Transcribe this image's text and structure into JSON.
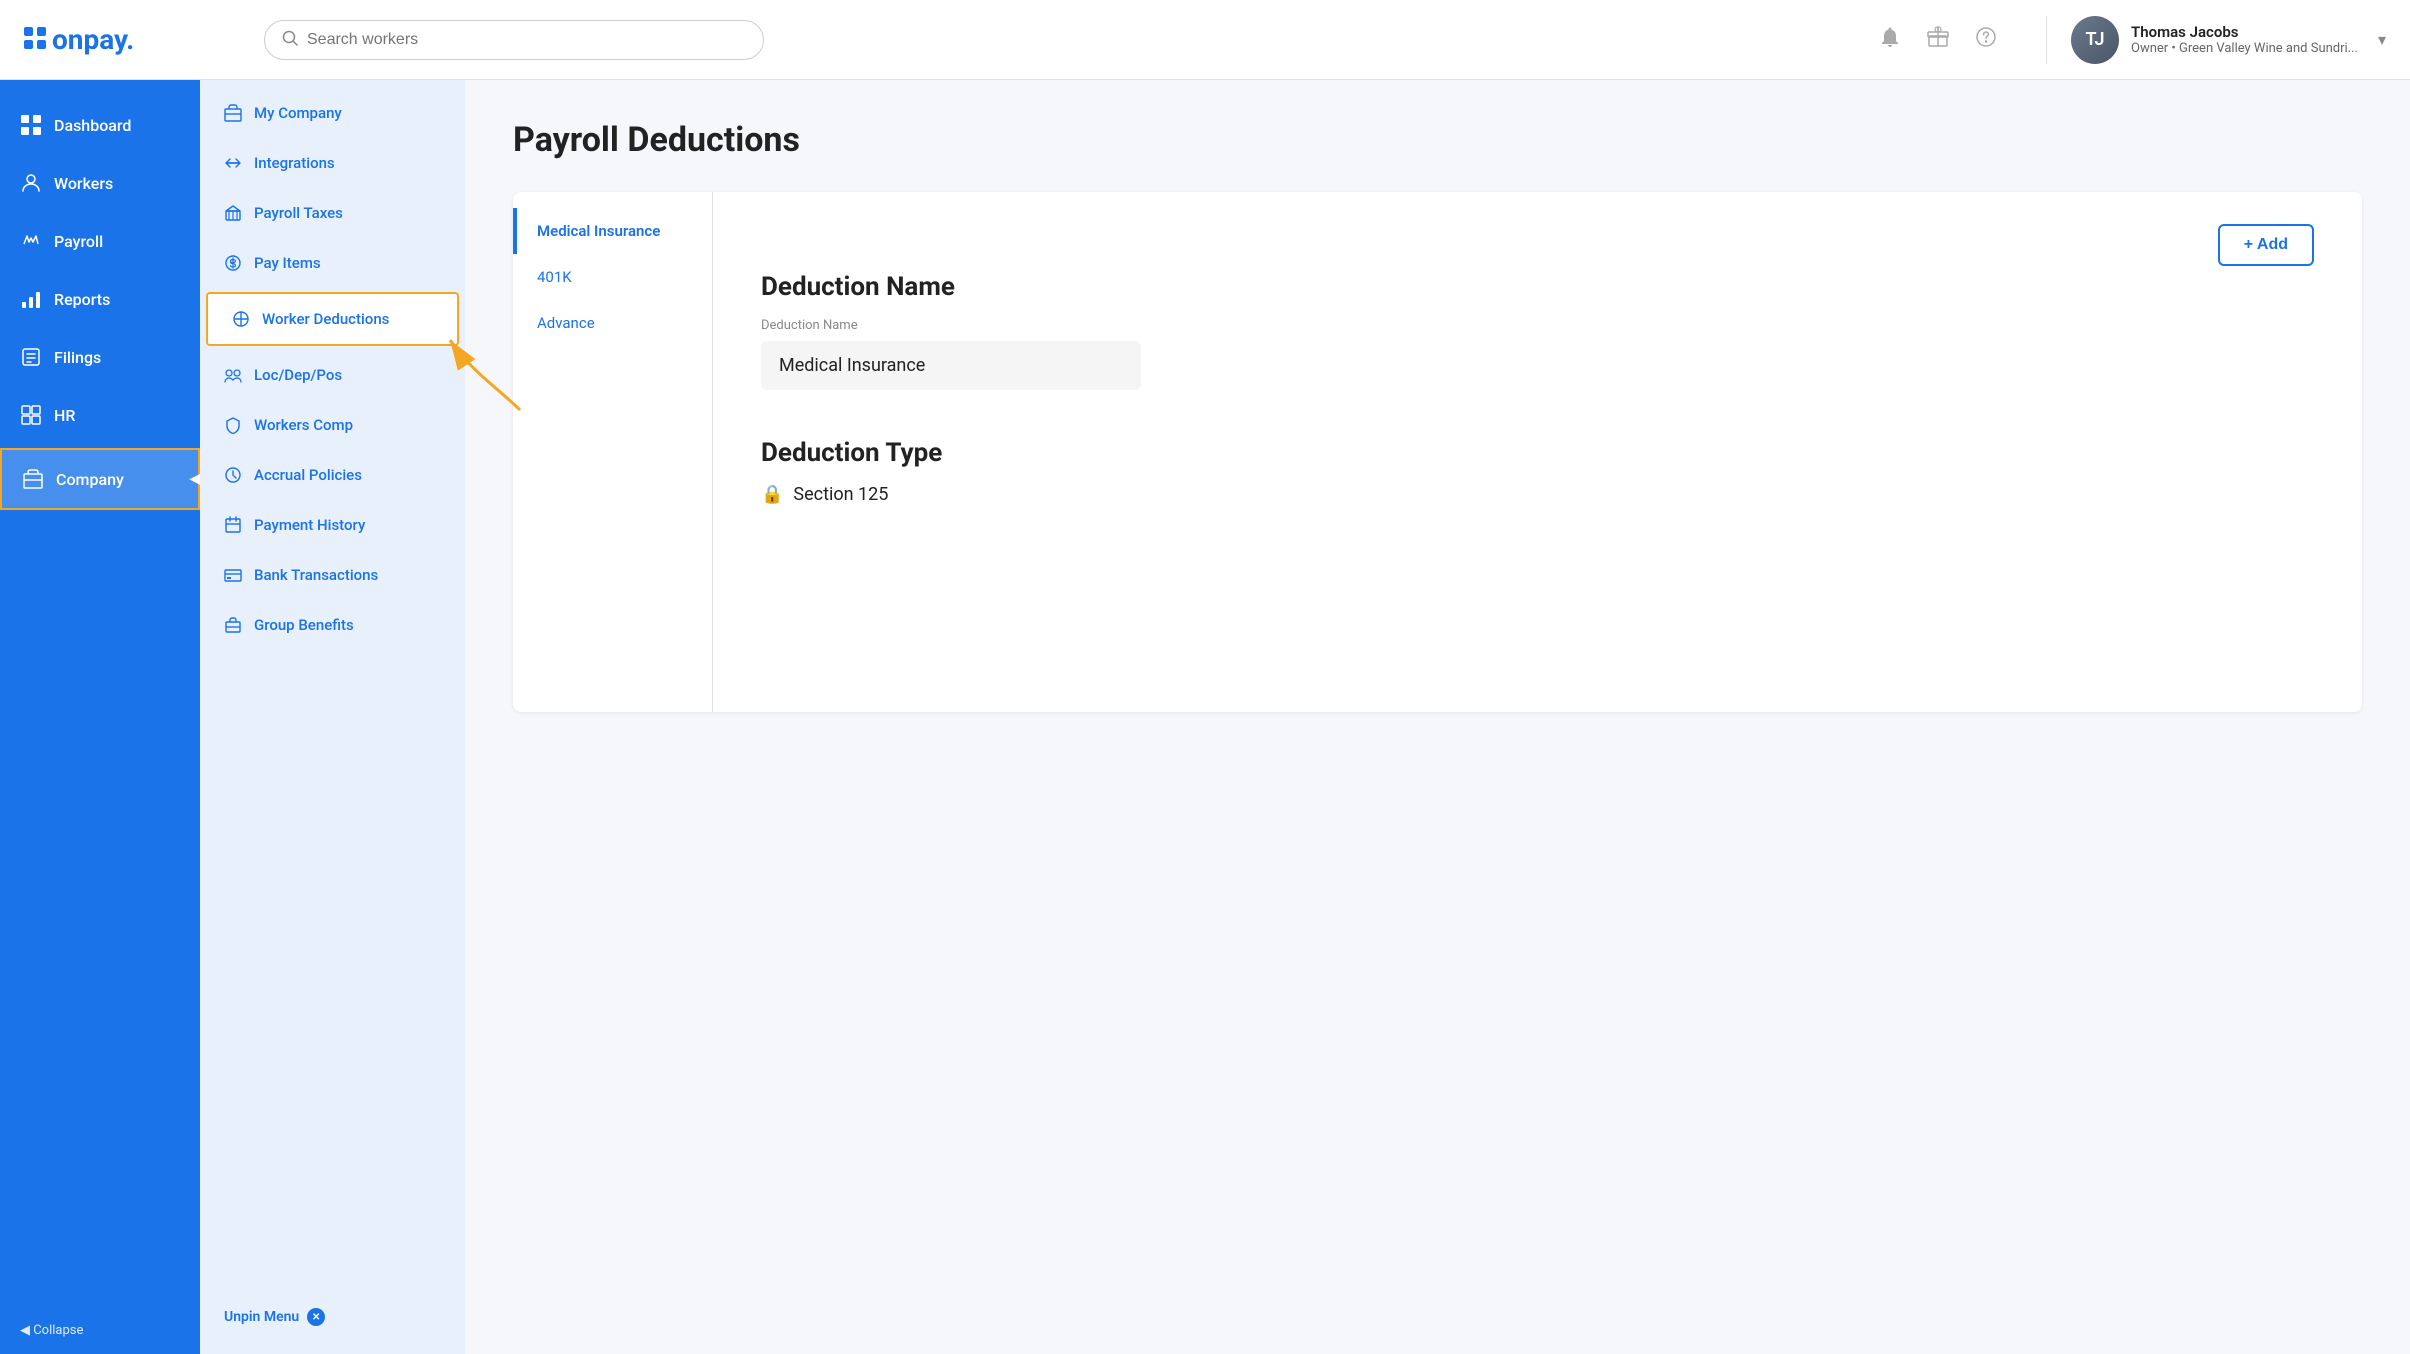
{
  "header": {
    "logo_text": "onpay.",
    "search_placeholder": "Search workers",
    "user_name": "Thomas Jacobs",
    "user_role": "Owner • Green Valley Wine and Sundri...",
    "dropdown_icon": "▾"
  },
  "sidebar": {
    "items": [
      {
        "id": "dashboard",
        "label": "Dashboard",
        "icon": "grid"
      },
      {
        "id": "workers",
        "label": "Workers",
        "icon": "person"
      },
      {
        "id": "payroll",
        "label": "Payroll",
        "icon": "hand"
      },
      {
        "id": "reports",
        "label": "Reports",
        "icon": "chart"
      },
      {
        "id": "filings",
        "label": "Filings",
        "icon": "filing"
      },
      {
        "id": "hr",
        "label": "HR",
        "icon": "hr"
      },
      {
        "id": "company",
        "label": "Company",
        "icon": "company",
        "active": true
      }
    ],
    "collapse_label": "◀ Collapse"
  },
  "sub_menu": {
    "items": [
      {
        "id": "my-company",
        "label": "My Company",
        "icon": "building"
      },
      {
        "id": "integrations",
        "label": "Integrations",
        "icon": "arrows"
      },
      {
        "id": "payroll-taxes",
        "label": "Payroll Taxes",
        "icon": "bank"
      },
      {
        "id": "pay-items",
        "label": "Pay Items",
        "icon": "dollar"
      },
      {
        "id": "worker-deductions",
        "label": "Worker Deductions",
        "icon": "deduction",
        "active": true
      },
      {
        "id": "loc-dep-pos",
        "label": "Loc/Dep/Pos",
        "icon": "group"
      },
      {
        "id": "workers-comp",
        "label": "Workers Comp",
        "icon": "shield"
      },
      {
        "id": "accrual-policies",
        "label": "Accrual Policies",
        "icon": "clock"
      },
      {
        "id": "payment-history",
        "label": "Payment History",
        "icon": "calendar"
      },
      {
        "id": "bank-transactions",
        "label": "Bank Transactions",
        "icon": "bank-tx"
      },
      {
        "id": "group-benefits",
        "label": "Group Benefits",
        "icon": "briefcase"
      }
    ],
    "unpin_label": "Unpin Menu",
    "unpin_icon": "✕"
  },
  "page": {
    "title": "Payroll Deductions",
    "add_button_label": "+ Add",
    "deductions": [
      {
        "id": "medical",
        "label": "Medical Insurance",
        "active": true
      },
      {
        "id": "401k",
        "label": "401K",
        "active": false
      },
      {
        "id": "advance",
        "label": "Advance",
        "active": false
      }
    ],
    "deduction_name_section": "Deduction Name",
    "deduction_name_field_label": "Deduction Name",
    "deduction_name_value": "Medical Insurance",
    "deduction_type_section": "Deduction Type",
    "deduction_type_value": "Section 125",
    "lock_icon": "🔒"
  }
}
